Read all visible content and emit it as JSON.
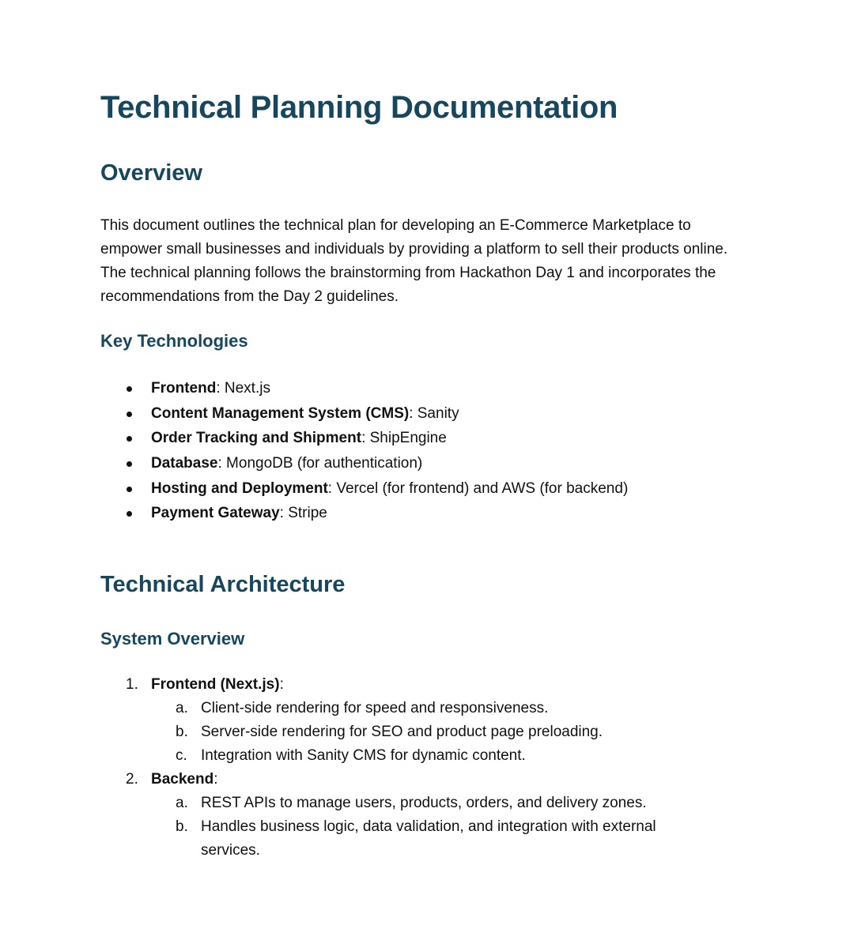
{
  "document": {
    "title": "Technical Planning Documentation",
    "overview": {
      "heading": "Overview",
      "paragraph": "This document outlines the technical plan for developing an E-Commerce Marketplace to empower small businesses and individuals by providing a platform to sell their products online. The technical planning follows the brainstorming from Hackathon Day 1 and incorporates the recommendations from the Day 2 guidelines."
    },
    "key_technologies": {
      "heading": "Key Technologies",
      "items": [
        {
          "term": "Frontend",
          "value": ": Next.js"
        },
        {
          "term": "Content Management System (CMS)",
          "value": ": Sanity"
        },
        {
          "term": "Order Tracking and Shipment",
          "value": ": ShipEngine"
        },
        {
          "term": "Database",
          "value": ": MongoDB (for authentication)"
        },
        {
          "term": "Hosting and Deployment",
          "value": ": Vercel (for frontend) and AWS (for backend)"
        },
        {
          "term": "Payment Gateway",
          "value": ": Stripe"
        }
      ]
    },
    "technical_architecture": {
      "heading": "Technical Architecture",
      "system_overview": {
        "heading": "System Overview",
        "items": [
          {
            "number": "1.",
            "term": "Frontend (Next.js)",
            "suffix": ":",
            "subitems": [
              {
                "letter": "a.",
                "text": "Client-side rendering for speed and responsiveness."
              },
              {
                "letter": "b.",
                "text": "Server-side rendering for SEO and product page preloading."
              },
              {
                "letter": "c.",
                "text": "Integration with Sanity CMS for dynamic content."
              }
            ]
          },
          {
            "number": "2.",
            "term": "Backend",
            "suffix": ":",
            "subitems": [
              {
                "letter": "a.",
                "text": "REST APIs to manage users, products, orders, and delivery zones."
              },
              {
                "letter": "b.",
                "text": "Handles business logic, data validation, and integration with external services."
              }
            ]
          }
        ]
      }
    }
  }
}
